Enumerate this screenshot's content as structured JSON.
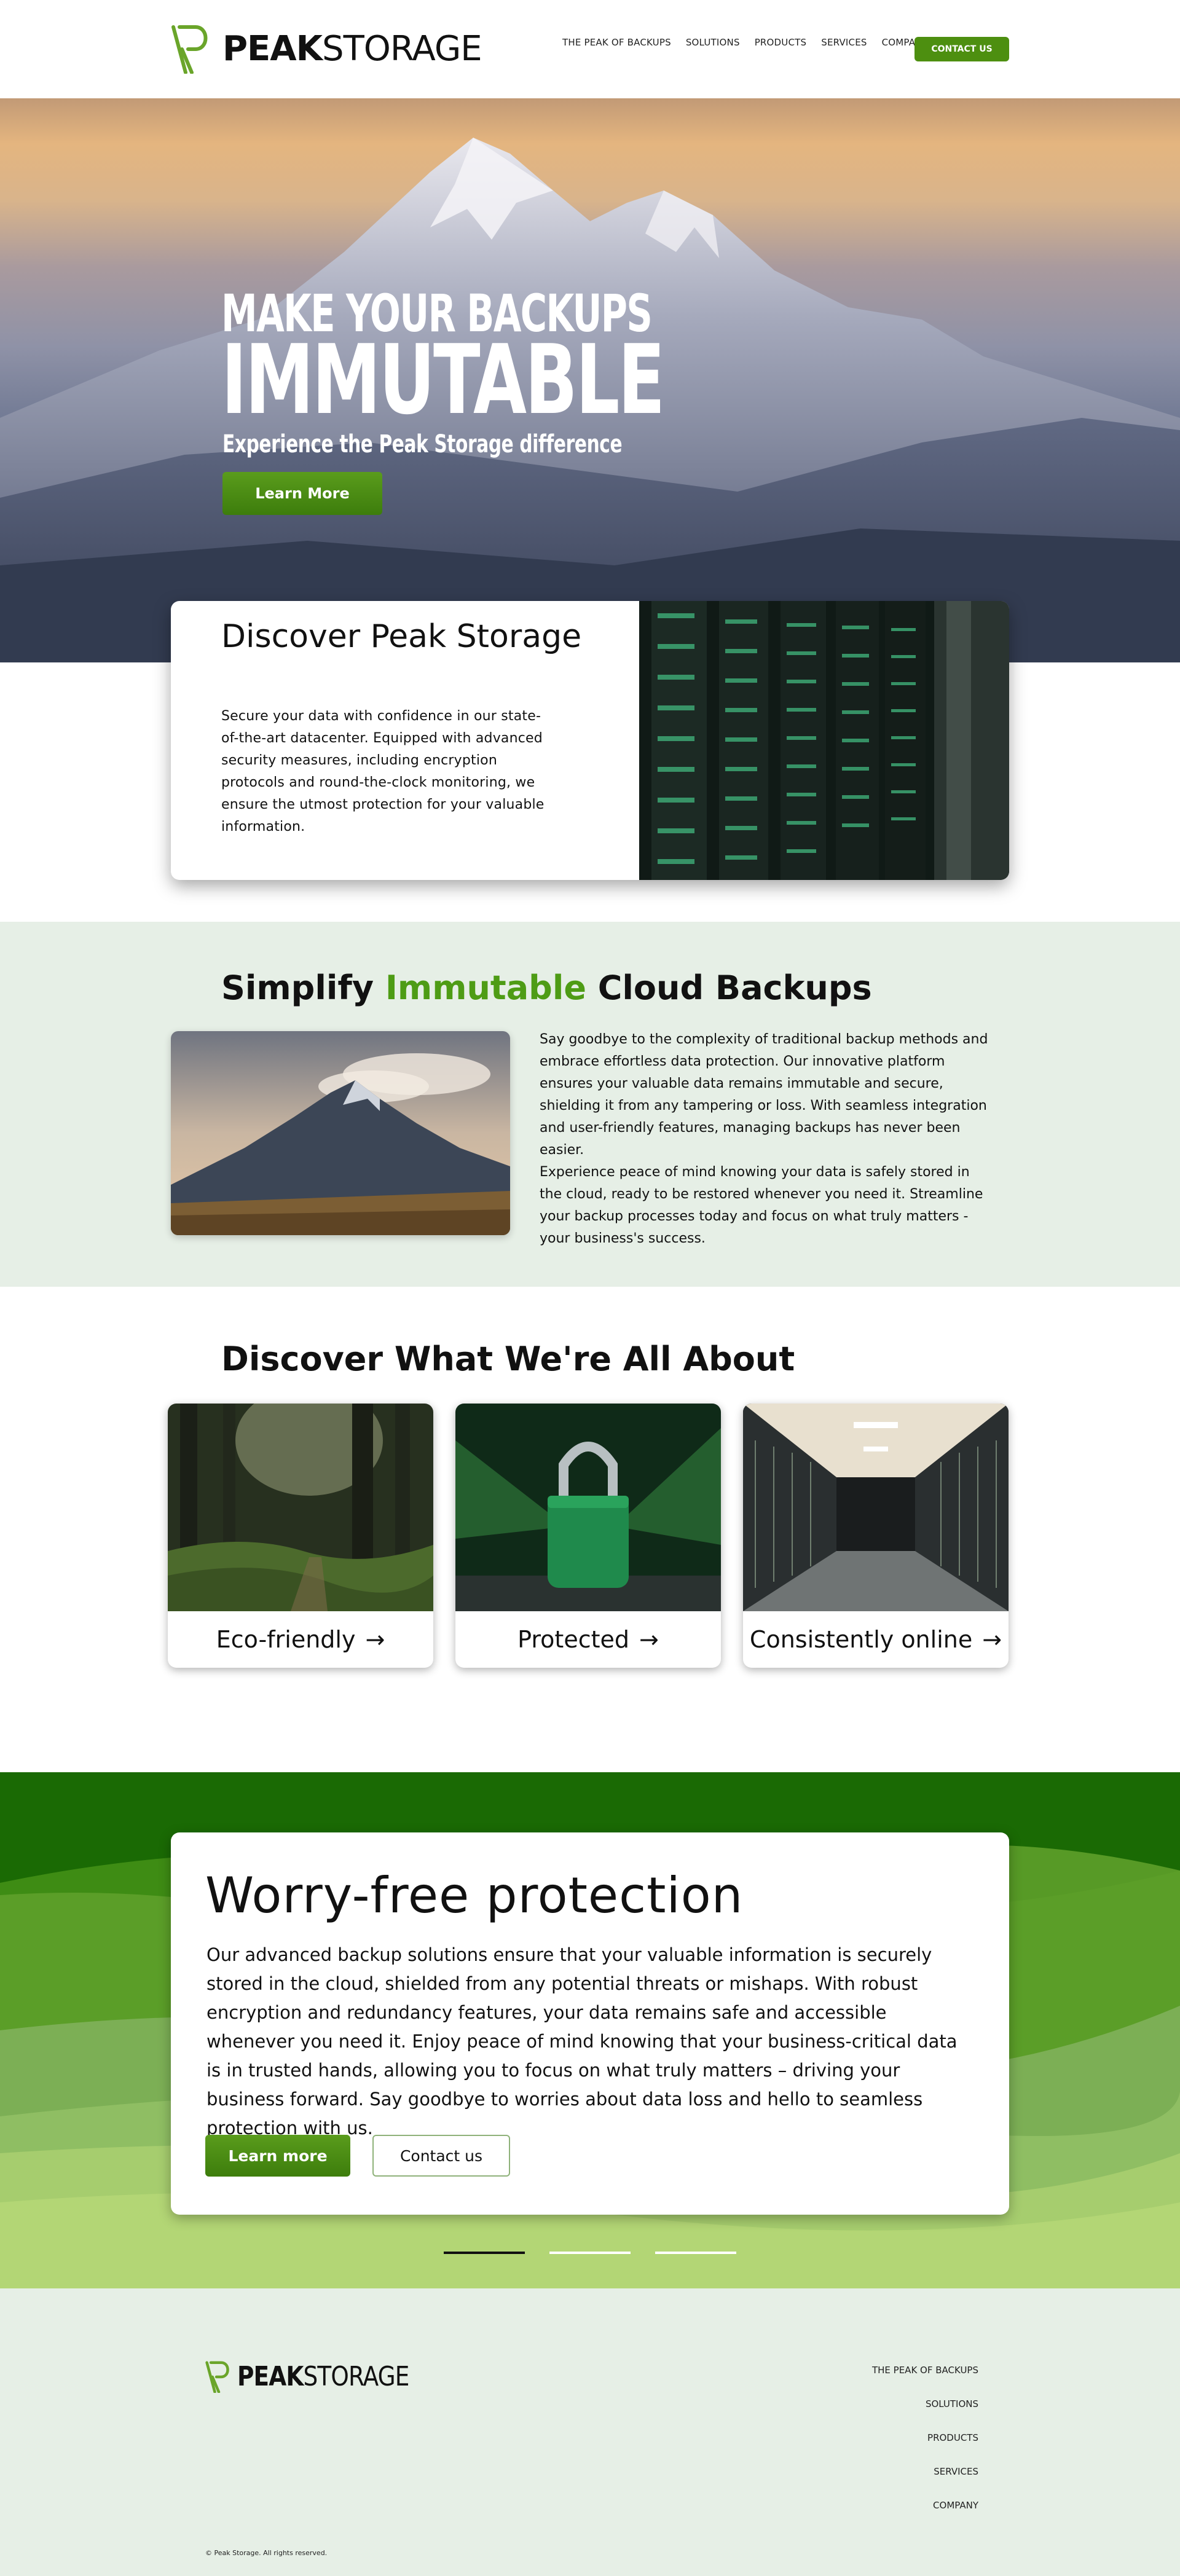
{
  "brand": {
    "name_bold": "PEAK",
    "name_regular": "STORAGE",
    "accent_color": "#4d8f10"
  },
  "nav": {
    "items": [
      "THE PEAK OF BACKUPS",
      "SOLUTIONS",
      "PRODUCTS",
      "SERVICES",
      "COMPANY"
    ],
    "contact_label": "CONTACT US"
  },
  "hero": {
    "line1": "MAKE YOUR BACKUPS",
    "line2": "IMMUTABLE",
    "subtitle": "Experience the Peak Storage difference",
    "button_label": "Learn More"
  },
  "discover": {
    "title": "Discover Peak Storage",
    "text": "Secure your data with confidence in our state-of-the-art datacenter. Equipped with advanced security measures, including encryption protocols and round-the-clock monitoring, we ensure the utmost protection for your valuable information."
  },
  "simplify": {
    "title_start": "Simplify ",
    "title_accent": "Immutable",
    "title_end": " Cloud Backups",
    "paragraph1": "Say goodbye to the complexity of traditional backup methods and embrace effortless data protection. Our innovative platform ensures your valuable data remains immutable and secure, shielding it from any tampering or loss. With seamless integration and user-friendly features, managing backups has never been easier.",
    "paragraph2": "Experience peace of mind knowing your data is safely stored in the cloud, ready to be restored whenever you need it. Streamline your backup processes today and focus on what truly matters - your business's success."
  },
  "about": {
    "title": "Discover What We're All About",
    "cards": [
      {
        "label": "Eco-friendly",
        "arrow": "→"
      },
      {
        "label": "Protected",
        "arrow": "→"
      },
      {
        "label": "Consistently online",
        "arrow": "→"
      }
    ]
  },
  "worry": {
    "title": "Worry-free protection",
    "text": "Our advanced backup solutions ensure that your valuable information is securely stored in the cloud, shielded from any potential threats or mishaps. With robust encryption and redundancy features, your data remains safe and accessible whenever you need it. Enjoy peace of mind knowing that your business-critical data is in trusted hands, allowing you to focus on what truly matters – driving your business forward. Say goodbye to worries about data loss and hello to seamless protection with us.",
    "primary_button": "Learn more",
    "secondary_button": "Contact us",
    "carousel_active_index": 0
  },
  "footer": {
    "nav": [
      "THE PEAK OF BACKUPS",
      "SOLUTIONS",
      "PRODUCTS",
      "SERVICES",
      "COMPANY"
    ],
    "copyright": "© Peak Storage. All rights reserved."
  }
}
